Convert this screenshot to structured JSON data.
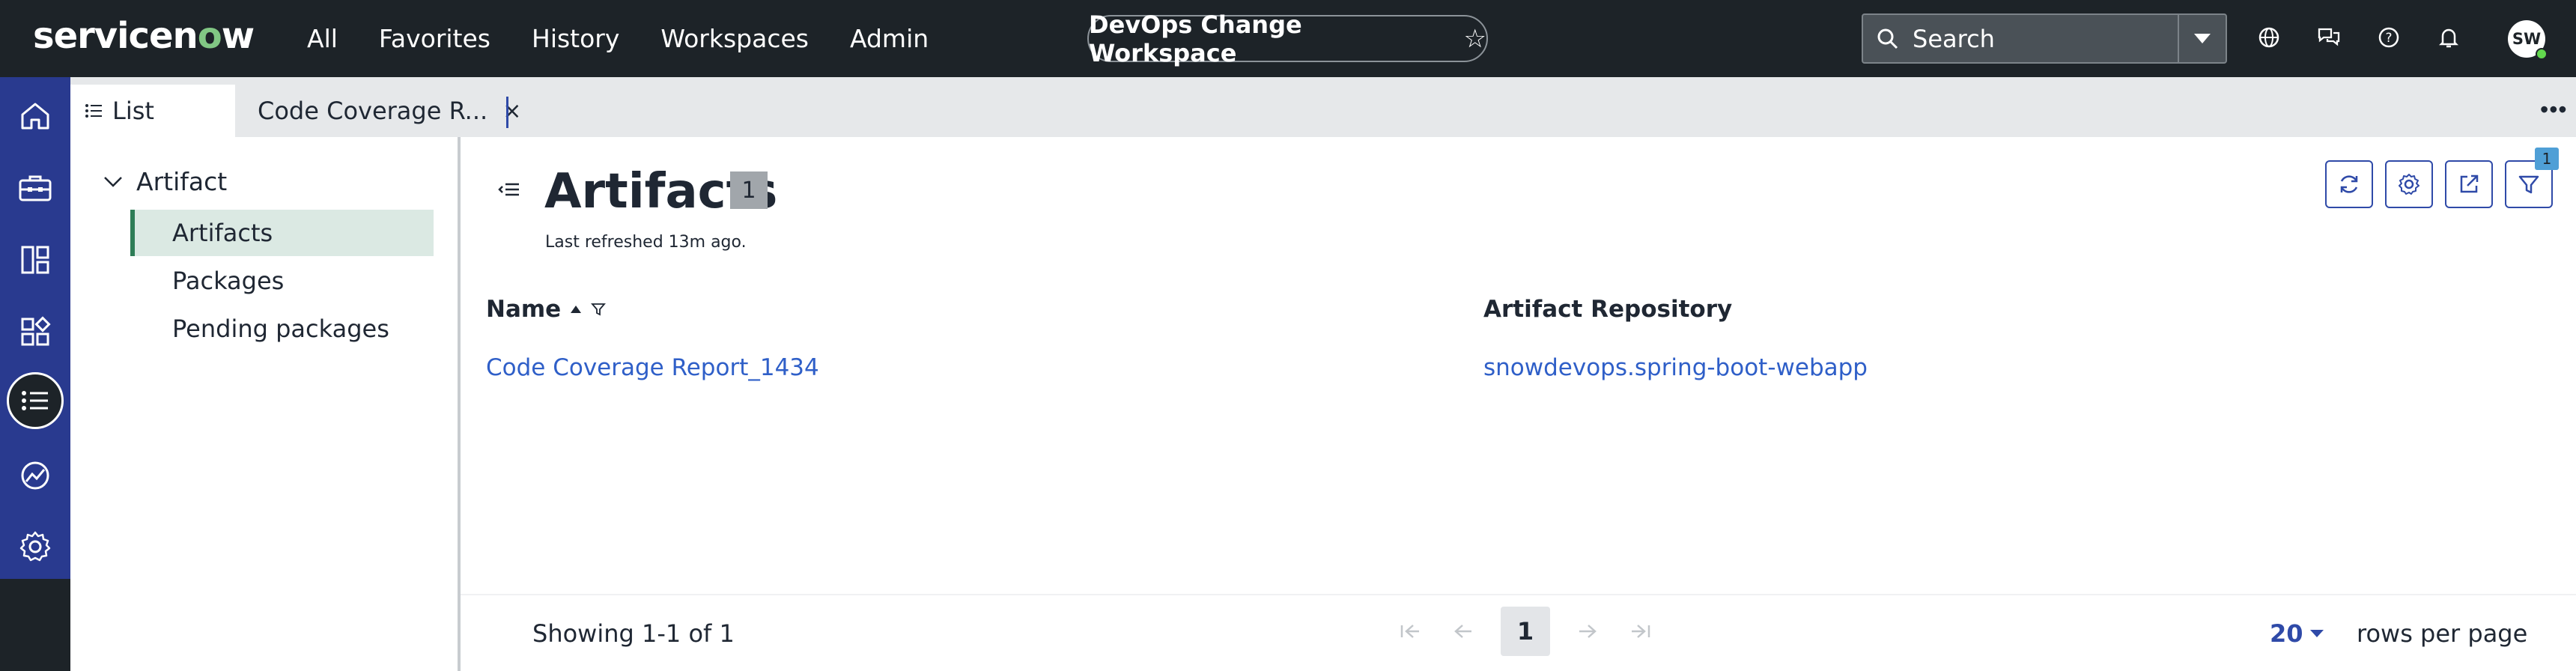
{
  "header": {
    "logo_text_pre": "servicen",
    "logo_text_o": "o",
    "logo_text_post": "w",
    "nav": [
      "All",
      "Favorites",
      "History",
      "Workspaces",
      "Admin"
    ],
    "workspace_title": "DevOps Change Workspace",
    "search_placeholder": "Search",
    "avatar_initials": "SW"
  },
  "tabs": {
    "list_label": "List",
    "record_label": "Code Coverage R..."
  },
  "tree": {
    "parent_label": "Artifact",
    "items": [
      "Artifacts",
      "Packages",
      "Pending packages"
    ],
    "selected": "Artifacts"
  },
  "main": {
    "title": "Artifacts",
    "count": "1",
    "last_refreshed": "Last refreshed 13m ago.",
    "filter_count": "1",
    "columns": [
      "Name",
      "Artifact Repository"
    ],
    "rows": [
      {
        "name": "Code Coverage Report_1434",
        "repository": "snowdevops.spring-boot-webapp"
      }
    ],
    "pagination": {
      "showing": "Showing 1-1 of 1",
      "current_page": "1",
      "rows_per_page_value": "20",
      "rows_per_page_label": "rows per page"
    }
  },
  "colors": {
    "header_bg": "#1d2328",
    "rail_bg": "#293a8f",
    "accent": "#2f4aa8",
    "link": "#2f5fc8",
    "selected_bg": "#dbe9e3",
    "selected_border": "#2e7d57"
  }
}
